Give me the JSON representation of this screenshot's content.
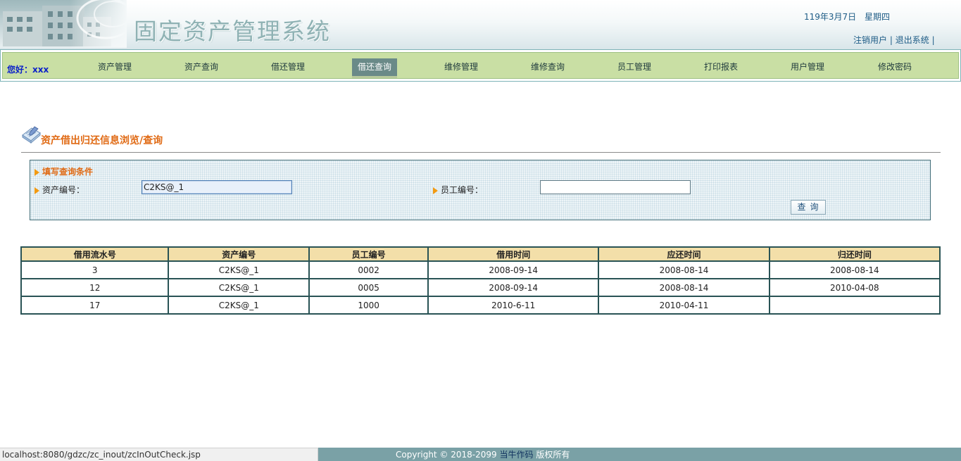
{
  "header": {
    "system_title": "固定资产管理系统",
    "date": "119年3月7日",
    "weekday": "星期四",
    "logout_user_link": "注销用户",
    "separator": "|",
    "exit_link": "退出系统",
    "trailing_separator": "|"
  },
  "nav": {
    "greeting": "您好：xxx",
    "items": [
      {
        "label": "资产管理"
      },
      {
        "label": "资产查询"
      },
      {
        "label": "借还管理"
      },
      {
        "label": "借还查询",
        "active": true
      },
      {
        "label": "维修管理"
      },
      {
        "label": "维修查询"
      },
      {
        "label": "员工管理"
      },
      {
        "label": "打印报表"
      },
      {
        "label": "用户管理"
      },
      {
        "label": "修改密码"
      }
    ]
  },
  "section": {
    "title": "资产借出归还信息浏览/查询"
  },
  "query": {
    "heading": "填写查询条件",
    "asset_no_label": "资产编号：",
    "asset_no_value": "C2KS@_1",
    "employee_no_label": "员工编号：",
    "employee_no_value": "",
    "search_button": "查询"
  },
  "table": {
    "columns": [
      "借用流水号",
      "资产编号",
      "员工编号",
      "借用时间",
      "应还时间",
      "归还时间"
    ],
    "rows": [
      [
        "3",
        "C2KS@_1",
        "0002",
        "2008-09-14",
        "2008-08-14",
        "2008-08-14"
      ],
      [
        "12",
        "C2KS@_1",
        "0005",
        "2008-09-14",
        "2008-08-14",
        "2010-04-08"
      ],
      [
        "17",
        "C2KS@_1",
        "1000",
        "2010-6-11",
        "2010-04-11",
        ""
      ]
    ]
  },
  "status_bar": {
    "url": "localhost:8080/gdzc/zc_inout/zcInOutCheck.jsp"
  },
  "footer": {
    "copyright": "Copyright © 2018-2099",
    "brand": "当牛作码",
    "rights": "版权所有"
  },
  "colors": {
    "nav_bg": "#c9dfa4",
    "active_tab": "#6a8a88",
    "accent_orange": "#e06a14",
    "table_header": "#f3dfa9",
    "table_border": "#295355",
    "footer_bg": "#7aa1a6"
  }
}
